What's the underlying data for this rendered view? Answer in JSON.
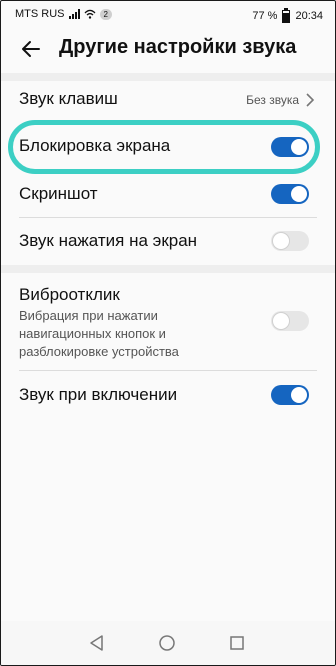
{
  "status_bar": {
    "carrier": "MTS RUS",
    "notification_count": "2",
    "battery_percent": "77 %",
    "time": "20:34",
    "icons": [
      "signal-icon",
      "wifi-icon",
      "battery-icon"
    ]
  },
  "header": {
    "title": "Другие настройки звука",
    "back_icon": "arrow-left-icon"
  },
  "settings": {
    "key_sound": {
      "label": "Звук клавиш",
      "value": "Без звука"
    },
    "screen_lock": {
      "label": "Блокировка экрана",
      "enabled": true
    },
    "screenshot": {
      "label": "Скриншот",
      "enabled": true
    },
    "touch_sound": {
      "label": "Звук нажатия на экран",
      "enabled": false
    },
    "vibration": {
      "label": "Виброотклик",
      "description_lines": [
        "Вибрация при нажатии",
        "навигационных кнопок и",
        "разблокировке устройства"
      ],
      "enabled": false
    },
    "power_on_sound": {
      "label": "Звук при включении",
      "enabled": true
    }
  },
  "highlight_color": "#3ccfc4",
  "accent_color": "#1565c0",
  "nav_bar": {
    "icons": [
      "back-triangle-icon",
      "home-circle-icon",
      "recents-square-icon"
    ]
  }
}
